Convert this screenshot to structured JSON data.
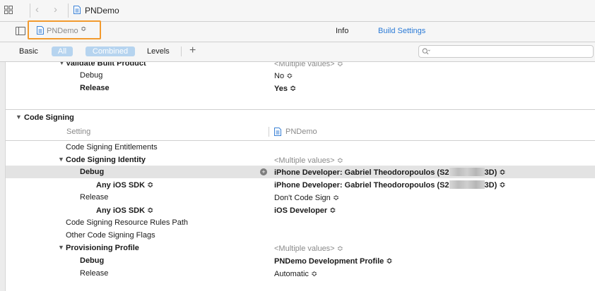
{
  "toolbar": {
    "breadcrumb_title": "PNDemo",
    "back_glyph": "‹",
    "forward_glyph": "›"
  },
  "target": {
    "name": "PNDemo",
    "chevron": "≎"
  },
  "tabs": {
    "info": "Info",
    "build_settings": "Build Settings"
  },
  "filters": {
    "basic": "Basic",
    "all": "All",
    "combined": "Combined",
    "levels": "Levels",
    "add": "+"
  },
  "search": {
    "placeholder": "",
    "icon": "search-icon"
  },
  "colors": {
    "accent": "#2a7ad6",
    "highlight_border": "#f29a2e",
    "pill": "#b6d4ef",
    "selected_row": "#e3e3e3"
  },
  "settings": {
    "validate_built_product": {
      "title": "Validate Built Product",
      "value": "<Multiple values> ≎",
      "debug_label": "Debug",
      "debug_value": "No ≎",
      "release_label": "Release",
      "release_value": "Yes ≎"
    },
    "code_signing": {
      "section_title": "Code Signing",
      "header_setting": "Setting",
      "header_target": "PNDemo",
      "entitlements": "Code Signing Entitlements",
      "identity": {
        "title": "Code Signing Identity",
        "value": "<Multiple values> ≎",
        "debug_label": "Debug",
        "debug_value_prefix": "iPhone Developer: Gabriel Theodoropoulos (S2",
        "debug_value_suffix": "3D) ≎",
        "debug_sdk_label": "Any iOS SDK ≎",
        "debug_sdk_value_prefix": "iPhone Developer: Gabriel Theodoropoulos (S2",
        "debug_sdk_value_suffix": "3D) ≎",
        "release_label": "Release",
        "release_value": "Don't Code Sign ≎",
        "release_sdk_label": "Any iOS SDK ≎",
        "release_sdk_value": "iOS Developer ≎"
      },
      "resource_rules": "Code Signing Resource Rules Path",
      "other_flags": "Other Code Signing Flags",
      "provisioning": {
        "title": "Provisioning Profile",
        "value": "<Multiple values> ≎",
        "debug_label": "Debug",
        "debug_value": "PNDemo Development Profile ≎",
        "release_label": "Release",
        "release_value": "Automatic ≎"
      }
    }
  }
}
